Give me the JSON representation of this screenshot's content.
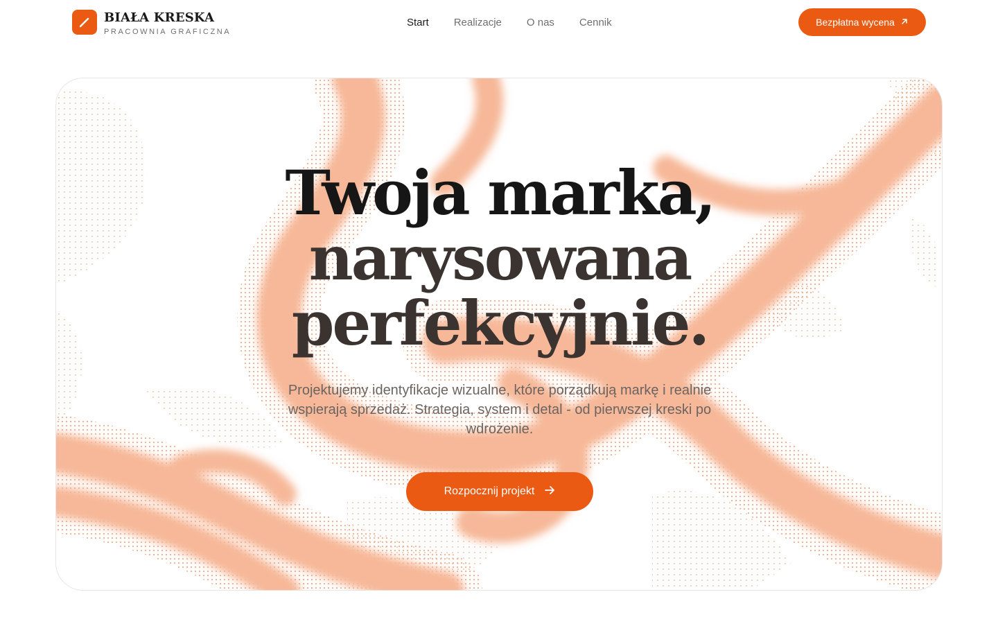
{
  "brand": {
    "name": "BIAŁA KRESKA",
    "tagline": "PRACOWNIA GRAFICZNA",
    "icon": "pen-stroke-icon",
    "accent_color": "#eb5a13"
  },
  "nav": {
    "items": [
      {
        "label": "Start",
        "active": true
      },
      {
        "label": "Realizacje",
        "active": false
      },
      {
        "label": "O nas",
        "active": false
      },
      {
        "label": "Cennik",
        "active": false
      }
    ]
  },
  "header_cta": {
    "label": "Bezpłatna wycena",
    "icon": "arrow-up-right-icon"
  },
  "hero": {
    "headline": [
      "Twoja marka,",
      "narysowana",
      "perfekcyjnie."
    ],
    "lead": "Projektujemy identyfikacje wizualne, które porządkują markę i realnie wspierają sprzedaż. Strategia, system i detal - od pierwszej kreski po wdrożenie.",
    "cta": {
      "label": "Rozpocznij projekt",
      "icon": "arrow-right-icon"
    },
    "background": {
      "pattern": "halftone-dot-swirl",
      "dot_color": "#f3a27d",
      "fill_color": "#f6b898"
    }
  }
}
